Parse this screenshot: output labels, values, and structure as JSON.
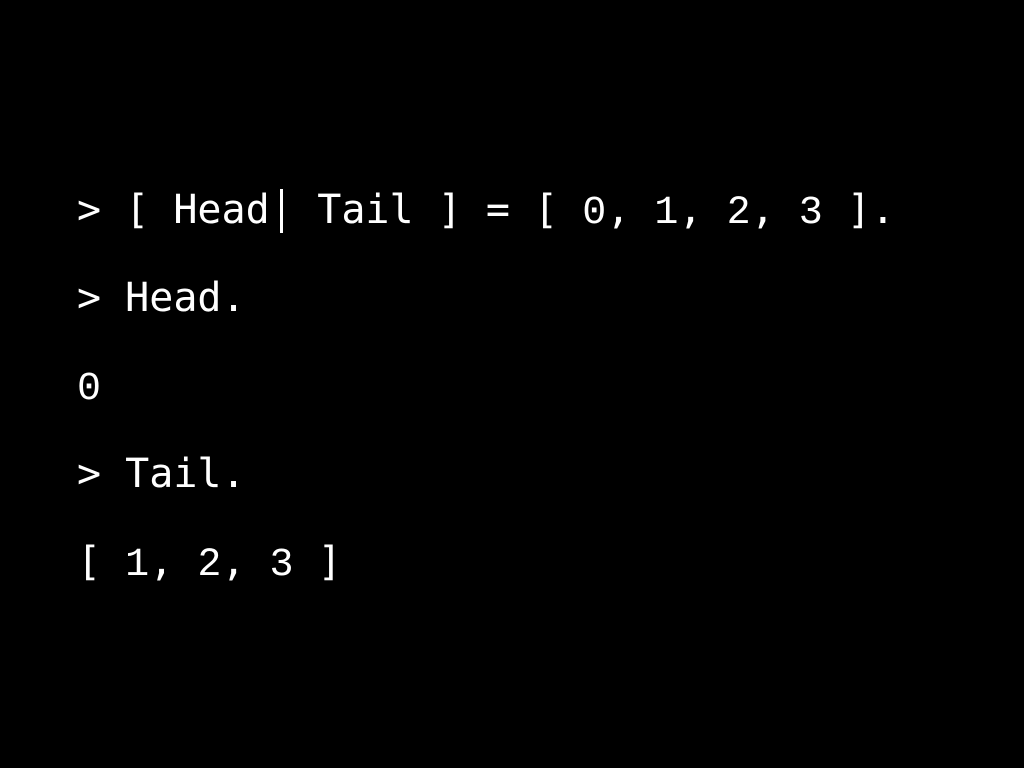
{
  "terminal": {
    "background_color": "#000000",
    "text_color": "#ffffff",
    "prompt_symbol": ">",
    "lines": [
      {
        "kind": "input",
        "text": "> [ Head | Tail ] = [ 0, 1, 2, 3 ].",
        "prompt": "> ",
        "seg_open_bracket": "[ ",
        "seg_head": "Head",
        "seg_pipe": "|",
        "seg_tail": " Tail ",
        "seg_close_bracket": "] ",
        "seg_equals": "= ",
        "seg_list_open": "[ ",
        "seg_n0": "0",
        "seg_c0": ", ",
        "seg_n1": "1",
        "seg_c1": ", ",
        "seg_n2": "2",
        "seg_c2": ", ",
        "seg_n3": "3",
        "seg_list_close": " ].",
        "values": [
          0,
          1,
          2,
          3
        ]
      },
      {
        "kind": "input",
        "text": "> Head.",
        "prompt": "> ",
        "expression": "Head."
      },
      {
        "kind": "output",
        "text": "0",
        "value": "0"
      },
      {
        "kind": "input",
        "text": "> Tail.",
        "prompt": "> ",
        "expression": "Tail."
      },
      {
        "kind": "output",
        "text": "[ 1, 2, 3 ]",
        "seg_list_open": "[ ",
        "seg_n1": "1",
        "seg_c1": ", ",
        "seg_n2": "2",
        "seg_c2": ", ",
        "seg_n3": "3",
        "seg_list_close": " ]",
        "values": [
          1,
          2,
          3
        ]
      }
    ]
  }
}
